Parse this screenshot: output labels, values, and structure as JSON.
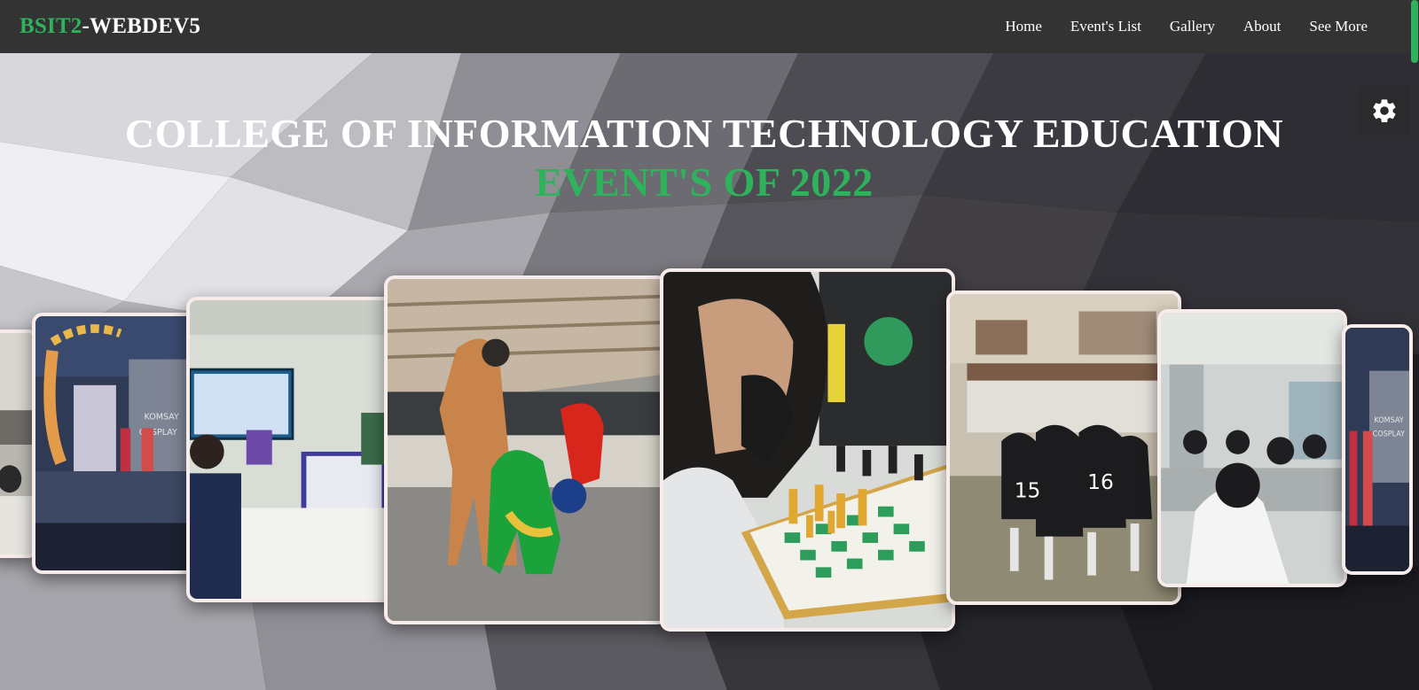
{
  "brand": {
    "part1": "BSIT2",
    "part2": "-WEBDEV5"
  },
  "nav": {
    "links": [
      "Home",
      "Event's List",
      "Gallery",
      "About",
      "See More"
    ]
  },
  "hero": {
    "title": "COLLEGE OF INFORMATION TECHNOLOGY EDUCATION",
    "subtitle": "EVENT'S OF 2022"
  },
  "gallery": {
    "photos": [
      {
        "subject": "covered court crowd"
      },
      {
        "subject": "cosplay stage event"
      },
      {
        "subject": "computer lab session"
      },
      {
        "subject": "mascot costumes"
      },
      {
        "subject": "chess tournament"
      },
      {
        "subject": "volleyball team huddle"
      },
      {
        "subject": "lab students"
      },
      {
        "subject": "cosplay stage event"
      }
    ],
    "stage_signs": [
      "KOMSAY",
      "COSPLAY"
    ]
  },
  "colors": {
    "accent": "#2fb25c",
    "navbar": "#333333",
    "card_border": "#f7ece9"
  },
  "icons": {
    "settings": "gear-icon"
  }
}
